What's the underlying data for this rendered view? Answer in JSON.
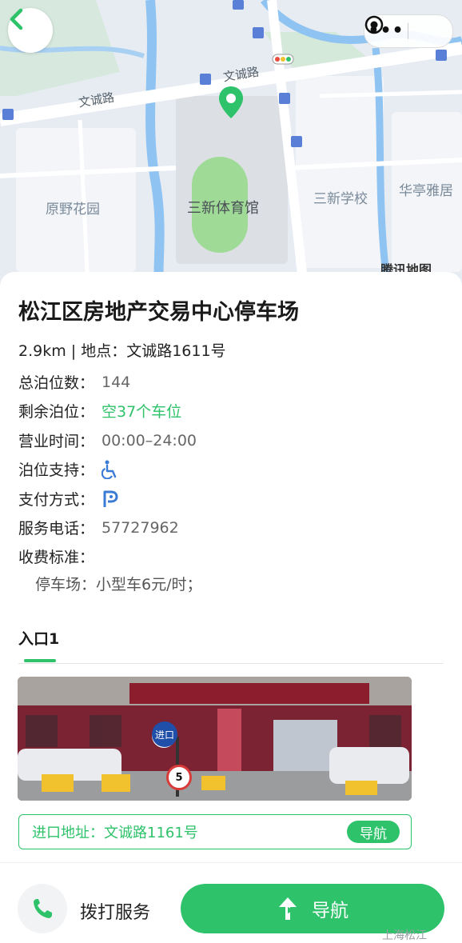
{
  "map": {
    "road_label_1": "文诚路",
    "road_label_2": "文诚路",
    "place_1": "原野花园",
    "place_2": "三新体育馆",
    "place_3": "三新学校",
    "place_4": "华亭雅居",
    "provider": "腾讯地图"
  },
  "header": {
    "back_icon": "chevron-left-icon",
    "more_label": "•••"
  },
  "detail": {
    "title": "松江区房地产交易中心停车场",
    "subline": "2.9km | 地点：文诚路1611号",
    "rows": [
      {
        "key": "总泊位数：",
        "value": "144"
      },
      {
        "key": "剩余泊位：",
        "value": "空37个车位"
      },
      {
        "key": "营业时间：",
        "value": "00:00–24:00"
      },
      {
        "key": "泊位支持：",
        "value": ""
      },
      {
        "key": "支付方式：",
        "value": ""
      },
      {
        "key": "服务电话：",
        "value": "57727962"
      },
      {
        "key": "收费标准：",
        "value": ""
      }
    ],
    "fee_item": "停车场：小型车6元/时；",
    "entry_tab": "入口1",
    "entry_address": "进口地址：文诚路1161号",
    "entry_nav": "导航"
  },
  "photo_signs": {
    "entry_sign": "进口",
    "speed_sign": "5"
  },
  "bottom": {
    "call_label": "拨打服务",
    "nav_label": "导航"
  },
  "watermark": "上海松江",
  "colors": {
    "accent": "#2ec26a",
    "map_bg": "#e6ebf2"
  }
}
